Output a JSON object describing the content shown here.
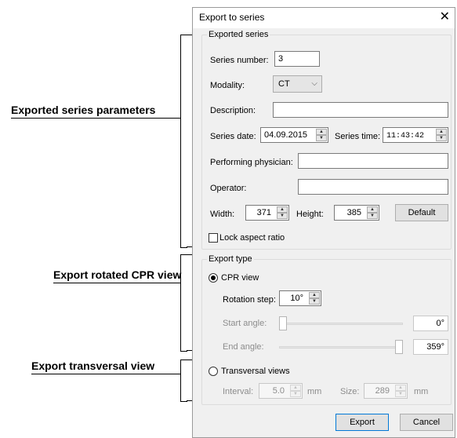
{
  "annotations": {
    "exported_series": "Exported series parameters",
    "rotated_cpr": "Export rotated CPR view",
    "transversal": "Export transversal view"
  },
  "dialog": {
    "title": "Export to series",
    "close_glyph": "✕",
    "exported_series": {
      "legend": "Exported series",
      "series_number_label": "Series number:",
      "series_number_value": "3",
      "modality_label": "Modality:",
      "modality_value": "CT",
      "description_label": "Description:",
      "description_value": "",
      "series_date_label": "Series date:",
      "series_date_value": "04.09.2015",
      "series_time_label": "Series time:",
      "series_time_value": "11:43:42",
      "performing_physician_label": "Performing physician:",
      "performing_physician_value": "",
      "operator_label": "Operator:",
      "operator_value": "",
      "width_label": "Width:",
      "width_value": "371",
      "height_label": "Height:",
      "height_value": "385",
      "default_button": "Default",
      "lock_aspect_label": "Lock aspect ratio",
      "lock_aspect_checked": false
    },
    "export_type": {
      "legend": "Export type",
      "cpr_view_label": "CPR view",
      "cpr_selected": true,
      "rotation_step_label": "Rotation step:",
      "rotation_step_value": "10°",
      "start_angle_label": "Start angle:",
      "start_angle_value": "0°",
      "start_angle_fraction": 0.0,
      "end_angle_label": "End angle:",
      "end_angle_value": "359°",
      "end_angle_fraction": 1.0,
      "transversal_label": "Transversal views",
      "transversal_selected": false,
      "interval_label": "Interval:",
      "interval_value": "5.0",
      "interval_unit": "mm",
      "size_label": "Size:",
      "size_value": "289",
      "size_unit": "mm"
    },
    "buttons": {
      "export": "Export",
      "cancel": "Cancel"
    }
  },
  "icons": {
    "spin_up": "▲",
    "spin_down": "▼",
    "chevron_down": "⌵"
  }
}
